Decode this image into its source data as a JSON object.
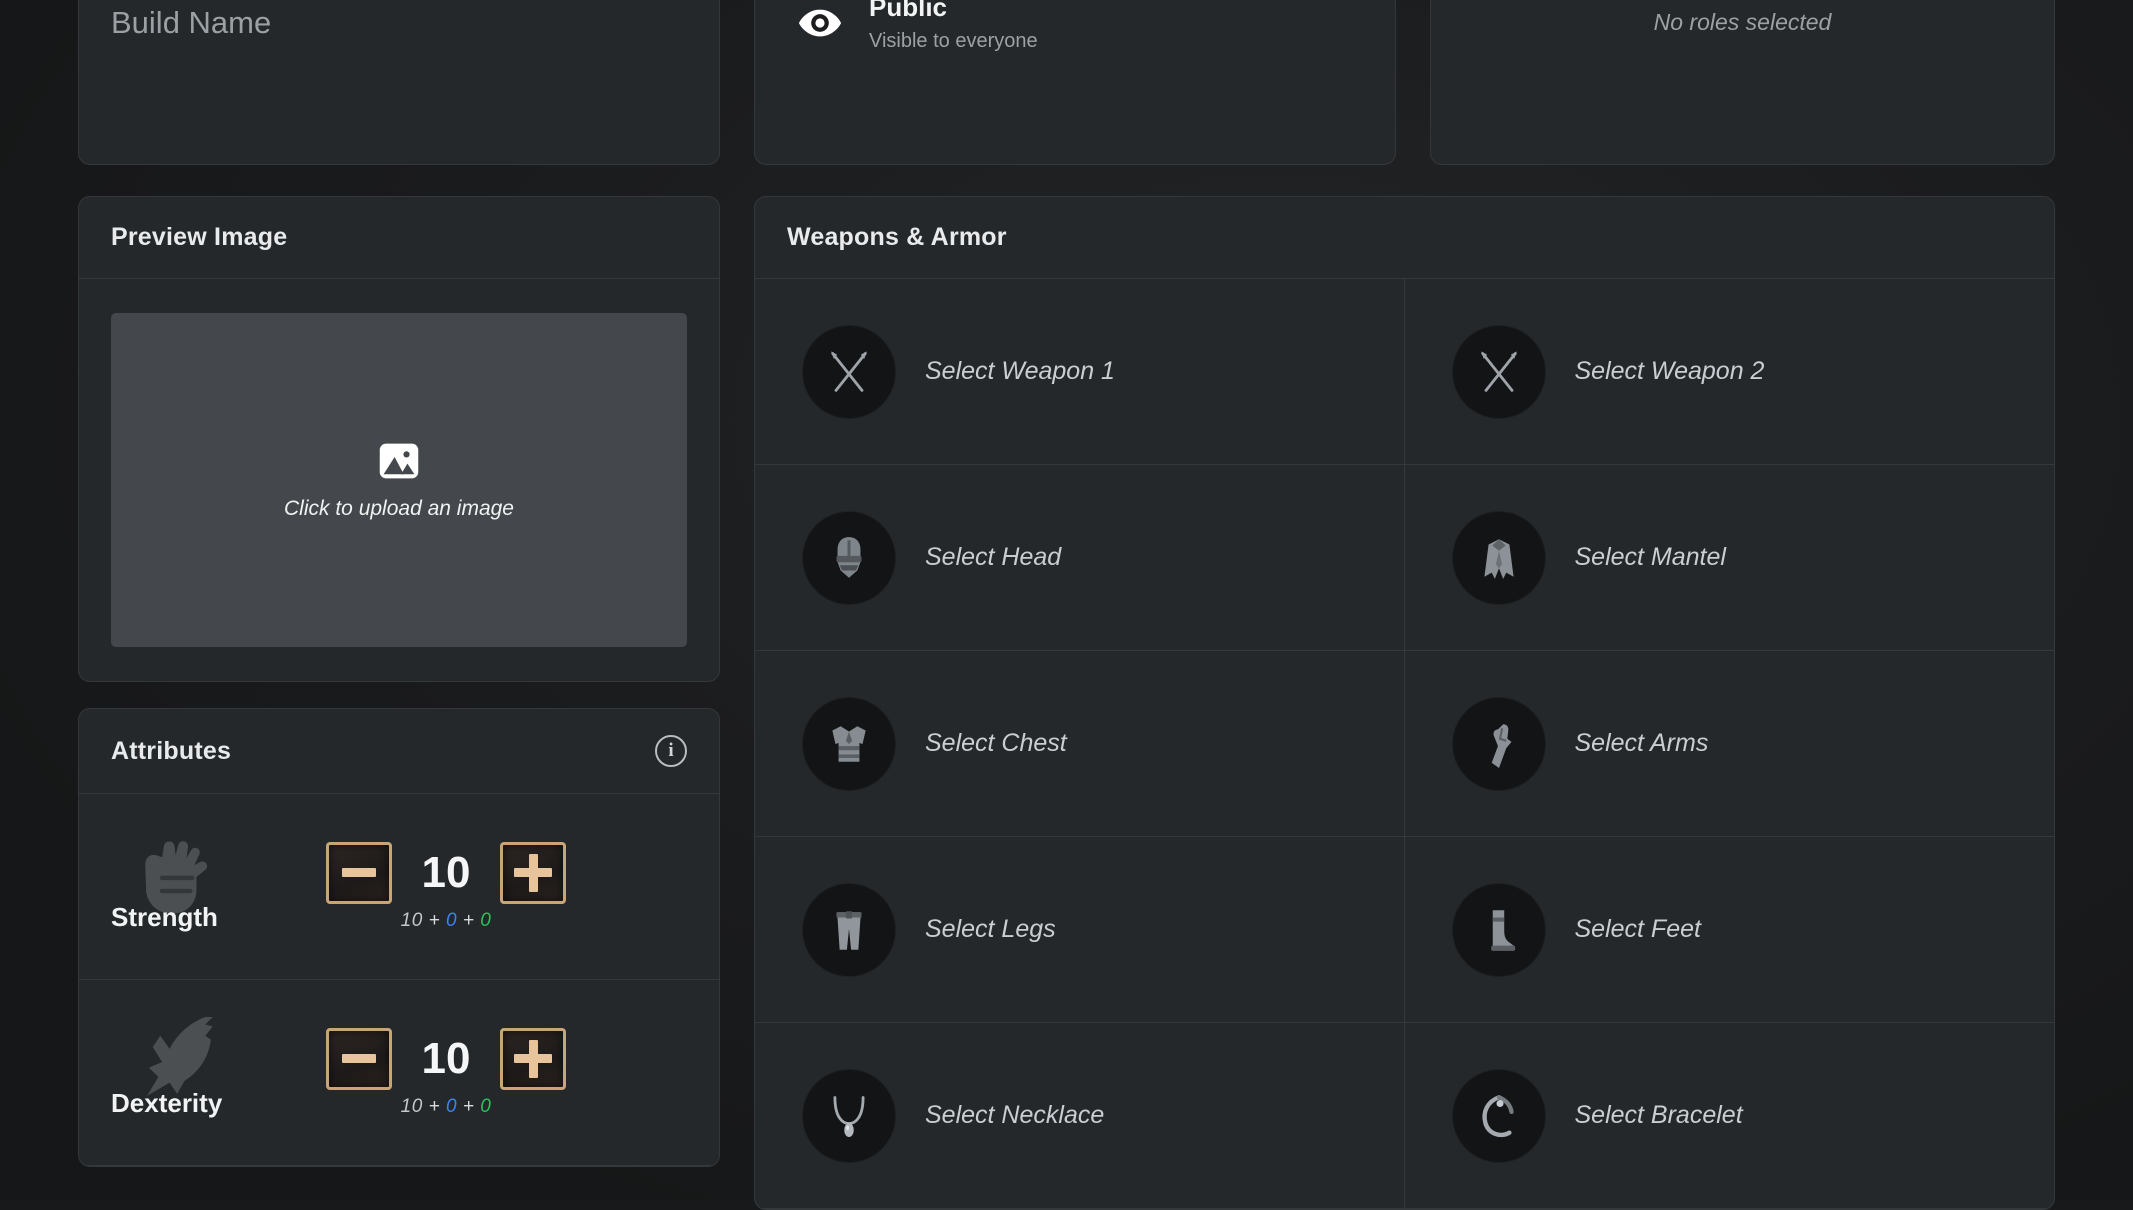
{
  "build": {
    "name_value": "",
    "name_placeholder": "Build Name"
  },
  "visibility": {
    "icon": "eye-icon",
    "title": "Public",
    "subtitle": "Visible to everyone"
  },
  "roles": {
    "empty_text": "No roles selected"
  },
  "preview": {
    "title": "Preview Image",
    "upload_icon": "image-icon",
    "upload_text": "Click to upload an image"
  },
  "attributes": {
    "title": "Attributes",
    "info_icon": "info-icon",
    "info_glyph": "i",
    "decrement_label": "−",
    "increment_label": "+",
    "rows": [
      {
        "name": "Strength",
        "icon": "fist-icon",
        "value": "10",
        "base": "10",
        "bonus_blue": "0",
        "bonus_green": "0",
        "plus": "+"
      },
      {
        "name": "Dexterity",
        "icon": "wing-icon",
        "value": "10",
        "base": "10",
        "bonus_blue": "0",
        "bonus_green": "0",
        "plus": "+"
      }
    ]
  },
  "gear": {
    "title": "Weapons & Armor",
    "slots": [
      {
        "label": "Select Weapon 1",
        "icon": "crossed-swords-icon"
      },
      {
        "label": "Select Weapon 2",
        "icon": "crossed-swords-icon"
      },
      {
        "label": "Select Head",
        "icon": "helmet-icon"
      },
      {
        "label": "Select Mantel",
        "icon": "cape-icon"
      },
      {
        "label": "Select Chest",
        "icon": "chestplate-icon"
      },
      {
        "label": "Select Arms",
        "icon": "gauntlet-icon"
      },
      {
        "label": "Select Legs",
        "icon": "trousers-icon"
      },
      {
        "label": "Select Feet",
        "icon": "boot-icon"
      },
      {
        "label": "Select Necklace",
        "icon": "necklace-icon"
      },
      {
        "label": "Select Bracelet",
        "icon": "bracelet-icon"
      }
    ]
  },
  "colors": {
    "page_bg": "#1b1c1e",
    "panel_bg": "#25282a",
    "panel_border": "#34383b",
    "accent_gold": "#c9a478",
    "glyph_gold": "#e7c49c",
    "bonus_blue": "#3b82f6",
    "bonus_green": "#22c55e",
    "upload_bg": "#44484c"
  }
}
